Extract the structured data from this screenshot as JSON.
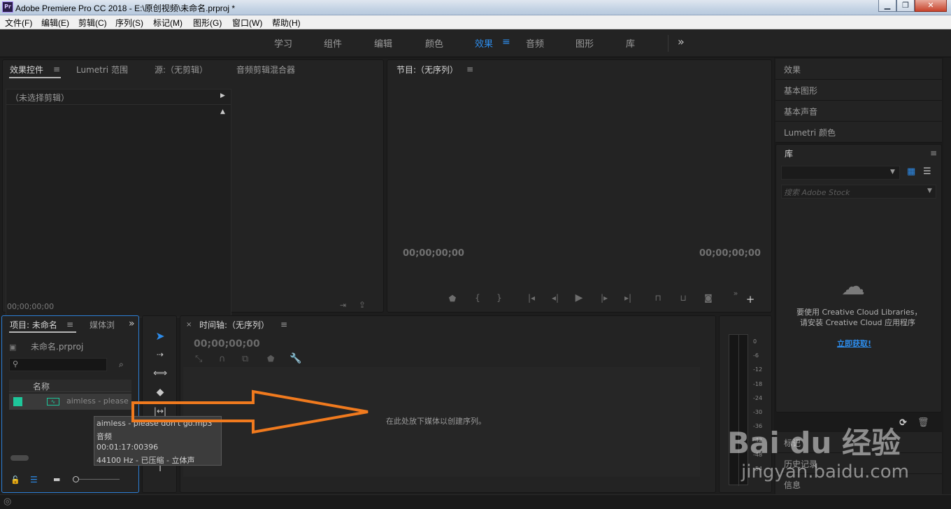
{
  "window": {
    "app_icon": "Pr",
    "title": "Adobe Premiere Pro CC 2018 - E:\\原创视频\\未命名.prproj *",
    "min": "▁",
    "max": "❐",
    "close": "✕"
  },
  "menubar": {
    "items": [
      "文件(F)",
      "编辑(E)",
      "剪辑(C)",
      "序列(S)",
      "标记(M)",
      "图形(G)",
      "窗口(W)",
      "帮助(H)"
    ]
  },
  "workspaces": {
    "items": [
      "学习",
      "组件",
      "编辑",
      "颜色",
      "效果",
      "音频",
      "图形",
      "库"
    ],
    "active": "效果",
    "more": "»"
  },
  "source_panel": {
    "tabs": [
      "效果控件",
      "Lumetri 范围",
      "源:（无剪辑）",
      "音频剪辑混合器"
    ],
    "no_clip": "（未选择剪辑）",
    "timecode": "00;00;00;00"
  },
  "program_panel": {
    "title": "节目:（无序列）",
    "timecode_left": "00;00;00;00",
    "timecode_right": "00;00;00;00"
  },
  "right_panel": {
    "items": [
      "效果",
      "基本图形",
      "基本声音",
      "Lumetri 颜色"
    ],
    "library_title": "库",
    "search_placeholder": "搜索 Adobe Stock",
    "cc_line1": "要使用 Creative Cloud Libraries，",
    "cc_line2": "请安装 Creative Cloud 应用程序",
    "cc_link": "立即获取!",
    "bottom_items": [
      "标记",
      "历史记录",
      "信息"
    ]
  },
  "project_panel": {
    "tabs": [
      "项目: 未命名",
      "媒体浏"
    ],
    "project_file": "未命名.prproj",
    "column_name": "名称",
    "clip_name": "aimless - please d",
    "tooltip": {
      "name": "aimless - please don't go.mp3",
      "type": "音频",
      "duration": "00:01:17:00396",
      "format": "44100 Hz - 已压缩 - 立体声"
    }
  },
  "timeline": {
    "title": "时间轴:（无序列）",
    "timecode": "00;00;00;00",
    "drop_hint": "在此处放下媒体以创建序列。"
  },
  "audio_meter": {
    "labels": [
      "0",
      "-6",
      "-12",
      "-18",
      "-24",
      "-30",
      "-36",
      "-42",
      "-48",
      "-54"
    ]
  },
  "watermark": {
    "brand": "Bai du 经验",
    "url": "jingyan.baidu.com"
  },
  "colors": {
    "accent": "#2d8ceb",
    "annotation_arrow": "#f07a1e",
    "clip_label": "#1ec69a"
  }
}
